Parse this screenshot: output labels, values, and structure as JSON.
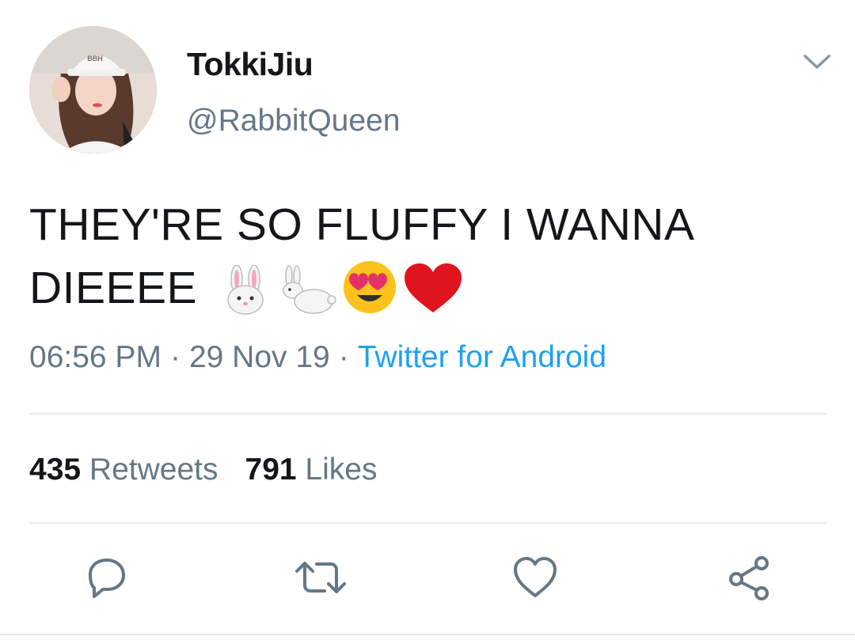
{
  "user": {
    "display_name": "TokkiJiu",
    "handle": "@RabbitQueen",
    "avatar_cap_text": "BBH"
  },
  "tweet": {
    "text_line1": "THEY'RE SO FLUFFY I WANNA",
    "text_line2": "DIEEEE",
    "emojis": [
      "rabbit-face",
      "rabbit",
      "heart-eyes",
      "red-heart"
    ]
  },
  "meta": {
    "time": "06:56 PM",
    "separator": "·",
    "date": "29 Nov 19",
    "source": "Twitter for Android"
  },
  "stats": {
    "retweets_count": "435",
    "retweets_label": "Retweets",
    "likes_count": "791",
    "likes_label": "Likes"
  },
  "actions": [
    "reply-icon",
    "retweet-icon",
    "like-icon",
    "share-icon"
  ],
  "colors": {
    "text": "#14171a",
    "secondary": "#657786",
    "link": "#1da1f2",
    "divider": "#e6ecf0"
  }
}
